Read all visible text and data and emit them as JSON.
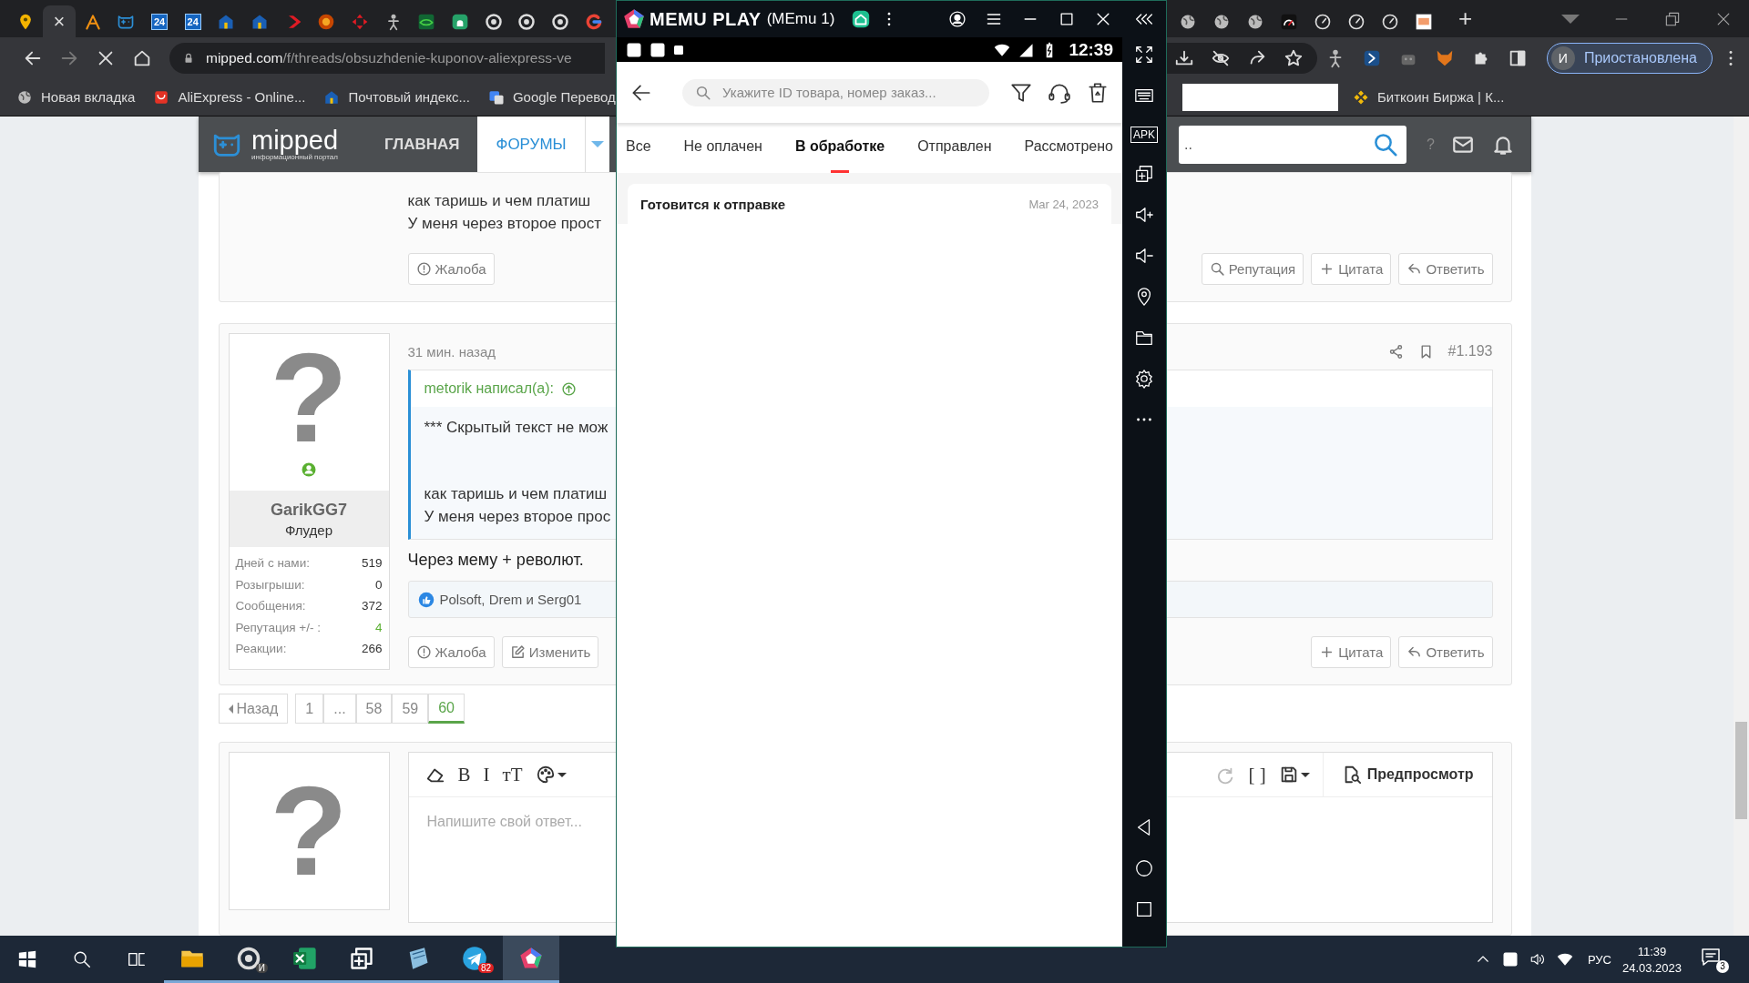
{
  "browser": {
    "tabs": [
      {
        "kind": "pin",
        "selected": false
      },
      {
        "kind": "x",
        "label": "×",
        "selected": true
      },
      {
        "kind": "peak",
        "selected": false
      },
      {
        "kind": "gamepad",
        "selected": false
      },
      {
        "kind": "date",
        "label": "24",
        "selected": false
      },
      {
        "kind": "date",
        "label": "24",
        "selected": false
      },
      {
        "kind": "house",
        "selected": false
      },
      {
        "kind": "house",
        "selected": false
      },
      {
        "kind": "chevron",
        "selected": false
      },
      {
        "kind": "flower",
        "selected": false
      },
      {
        "kind": "crossarrows",
        "selected": false
      },
      {
        "kind": "figure",
        "selected": false
      },
      {
        "kind": "eye",
        "selected": false
      },
      {
        "kind": "chef",
        "selected": false
      },
      {
        "kind": "ring",
        "selected": false
      },
      {
        "kind": "ring",
        "selected": false
      },
      {
        "kind": "ring",
        "selected": false
      },
      {
        "kind": "gring",
        "selected": false
      }
    ],
    "tabs_right": [
      {
        "kind": "globe",
        "selected": false
      },
      {
        "kind": "globe",
        "selected": false
      },
      {
        "kind": "globe",
        "selected": false
      },
      {
        "kind": "speedo",
        "selected": false
      },
      {
        "kind": "gauge",
        "selected": false
      },
      {
        "kind": "gauge",
        "selected": false
      },
      {
        "kind": "gauge",
        "selected": false
      },
      {
        "kind": "thumb",
        "selected": false
      }
    ],
    "new_tab": "+",
    "url_host": "mipped.com",
    "url_path": "/f/threads/obsuzhdenie-kuponov-aliexpress-ve",
    "profile": {
      "initial": "И",
      "status": "Приостановлена"
    },
    "bookmarks": [
      {
        "kind": "globe",
        "label": "Новая вкладка"
      },
      {
        "kind": "bag",
        "label": "AliExpress - Online..."
      },
      {
        "kind": "house",
        "label": "Почтовый индекс..."
      },
      {
        "kind": "translate",
        "label": "Google Перевод"
      }
    ],
    "bookmarks_right": [
      {
        "kind": "diamond",
        "label": "Биткоин Биржа | К..."
      }
    ]
  },
  "forum": {
    "logo": {
      "name": "mipped",
      "tagline": "информационный портал"
    },
    "nav": [
      {
        "label": "ГЛАВНАЯ",
        "selected": false
      },
      {
        "label": "ФОРУМЫ",
        "selected": true
      }
    ],
    "search": {
      "placeholder": ".."
    },
    "help": "?",
    "posts": [
      {
        "lines": [
          "как таришь и чем платиш",
          "У меня через второе прост"
        ],
        "actions_left": [
          {
            "kind": "report",
            "label": "Жалоба"
          }
        ],
        "actions_right": [
          {
            "kind": "search",
            "label": "Репутация"
          },
          {
            "kind": "plus",
            "label": "Цитата"
          },
          {
            "kind": "reply",
            "label": "Ответить"
          }
        ]
      },
      {
        "user": {
          "avatar": "?",
          "name": "GarikGG7",
          "title": "Флудер",
          "stats": [
            {
              "kind": "count",
              "label": "Дней с нами:",
              "value": "519"
            },
            {
              "kind": "count",
              "label": "Розыгрыши:",
              "value": "0"
            },
            {
              "kind": "count",
              "label": "Сообщения:",
              "value": "372"
            },
            {
              "kind": "reputation",
              "label": "Репутация +/- :",
              "value": "4"
            },
            {
              "kind": "count",
              "label": "Реакции:",
              "value": "266"
            }
          ]
        },
        "time": "31 мин. назад",
        "number": "#1.193",
        "quote": {
          "author": "metorik написал(а):",
          "hidden": "*** Скрытый текст не мож",
          "lines": [
            "как таришь и чем платиш",
            "У меня через второе прос"
          ]
        },
        "body": "Через мему + револют.",
        "reactions": "Polsoft, Drem и Serg01",
        "actions_left": [
          {
            "kind": "report",
            "label": "Жалоба"
          },
          {
            "kind": "edit",
            "label": "Изменить"
          }
        ],
        "actions_right": [
          {
            "kind": "plus",
            "label": "Цитата"
          },
          {
            "kind": "reply",
            "label": "Ответить"
          }
        ]
      }
    ],
    "pagination": {
      "prev": "Назад",
      "pages": [
        {
          "label": "1",
          "selected": false
        },
        {
          "label": "...",
          "selected": false
        },
        {
          "label": "58",
          "selected": false
        },
        {
          "label": "59",
          "selected": false
        },
        {
          "label": "60",
          "selected": true
        }
      ]
    },
    "editor": {
      "avatar": "?",
      "tools_left": [
        {
          "kind": "eraser"
        },
        {
          "kind": "glyph",
          "label": "B"
        },
        {
          "kind": "glyph",
          "label": "I"
        },
        {
          "kind": "glyph",
          "label": "тT"
        },
        {
          "kind": "palette"
        }
      ],
      "tools_right": [
        {
          "kind": "redo"
        },
        {
          "kind": "glyph",
          "label": "[ ]"
        },
        {
          "kind": "save"
        }
      ],
      "preview": "Предпросмотр",
      "placeholder": "Напишите свой ответ..."
    }
  },
  "emulator": {
    "title": "MEMU PLAY",
    "instance": "(MEmu 1)",
    "apk": "APK",
    "time": "12:39",
    "app": {
      "search_placeholder": "Укажите ID товара, номер заказ...",
      "tabs": [
        {
          "label": "Все",
          "selected": false
        },
        {
          "label": "Не оплачен",
          "selected": false
        },
        {
          "label": "В обработке",
          "selected": true
        },
        {
          "label": "Отправлен",
          "selected": false
        },
        {
          "label": "Рассмотрено",
          "selected": false
        }
      ],
      "orders": [
        {
          "status": "Готовится к отправке",
          "date": "Mar 24, 2023"
        }
      ]
    }
  },
  "taskbar": {
    "apps": [
      {
        "kind": "explorer",
        "selected": false
      },
      {
        "kind": "ring",
        "badge": "И",
        "selected": false
      },
      {
        "kind": "excel",
        "selected": false
      },
      {
        "kind": "multi",
        "selected": false
      },
      {
        "kind": "notepad",
        "selected": false
      },
      {
        "kind": "telegram",
        "badge": "82",
        "selected": false
      },
      {
        "kind": "memu",
        "selected": true
      }
    ],
    "lang": "РУС",
    "time": "11:39",
    "date": "24.03.2023",
    "notifications": "3"
  }
}
